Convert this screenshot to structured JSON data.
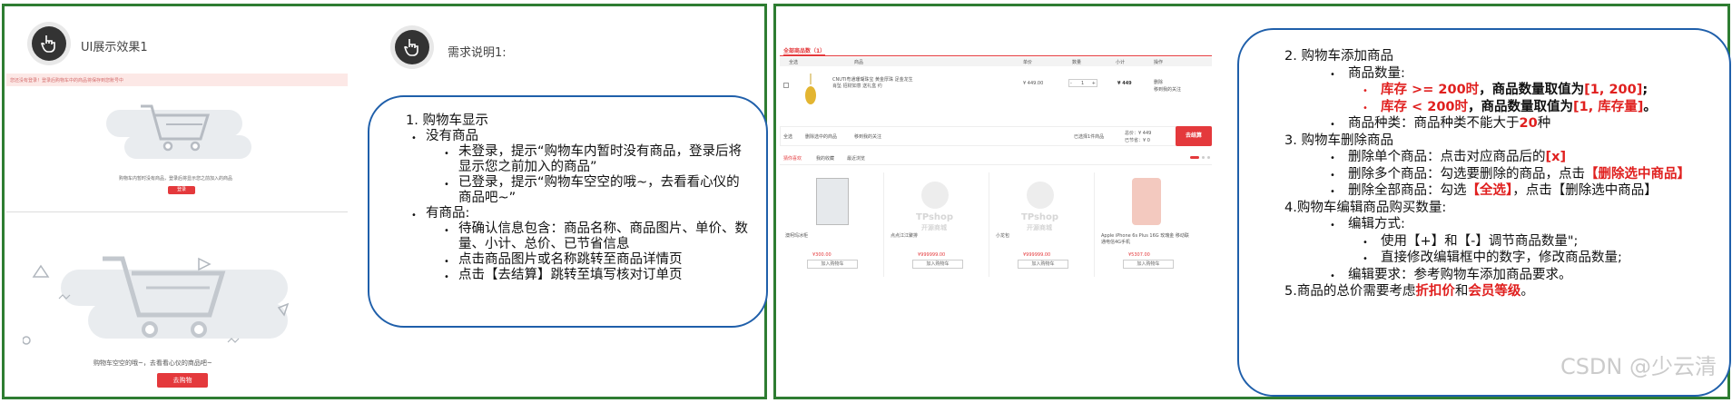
{
  "left_panel": {
    "title": "UI展示效果1",
    "notice_bar": "您还没有登录！登录后购物车中的商品将保存到您账号中",
    "empty1_text": "购物车内暂时没有商品，登录后将显示您之前加入的商品",
    "empty1_button": "登录",
    "empty2_text": "购物车空空的哦~，去看看心仪的商品吧~",
    "empty2_button": "去购物"
  },
  "requirements_panel": {
    "title": "需求说明1:",
    "heading": "1. 购物车显示",
    "no_items": "没有商品",
    "not_logged": "未登录，提示“购物车内暂时没有商品，登录后将显示您之前加入的商品”",
    "logged": "已登录，提示“购物车空空的哦~，去看看心仪的商品吧~”",
    "has_items": "有商品:",
    "item1": "待确认信息包含：商品名称、商品图片、单价、数量、小计、总价、已节省信息",
    "item2": "点击商品图片或名称跳转至商品详情页",
    "item3": "点击【去结算】跳转至填写核对订单页"
  },
  "cart_mock": {
    "tab": "全部商品数（1）",
    "headers": [
      "全选",
      "商品",
      "单价",
      "数量",
      "小计",
      "操作"
    ],
    "row": {
      "name": "CNUTI粤通珊瑚珠宝 黄金厚珠 足金龙生肖坠 招财如意 送礼盒 约",
      "price": "¥ 449.00",
      "qty": "1",
      "subtotal": "¥ 449",
      "ops": [
        "删除",
        "移到我的关注"
      ]
    },
    "footer": {
      "select_all": "全选",
      "delete_selected": "删除选中的商品",
      "move": "移到我的关注",
      "selected_count": "已选择1件商品",
      "total": "总价：¥ 449",
      "saved": "已节省：¥ 0",
      "checkout": "去结算"
    },
    "rec_tabs": [
      "猜你喜欢",
      "我的收藏",
      "最近浏览"
    ],
    "products": [
      {
        "name": "澳柯玛冰柜",
        "price": "¥300.00",
        "add": "加入购物车"
      },
      {
        "name": "点点江江聚排",
        "price": "¥999999.00",
        "add": "加入购物车"
      },
      {
        "name": "小龙包",
        "price": "¥999999.00",
        "add": "加入购物车"
      },
      {
        "name": "Apple iPhone 6s Plus 16G 玫瑰金 移动联通电信4G手机",
        "price": "¥5307.00",
        "add": "加入购物车"
      }
    ],
    "placeholder_text": "TPshop",
    "placeholder_sub": "开源商城"
  },
  "rules_panel": {
    "s2": "2. 购物车添加商品",
    "s2_qty": "商品数量:",
    "s2_rule1_red": "库存 >= 200时",
    "s2_rule1_mid": "，商品数量取值为",
    "s2_rule1_val": "[1, 200]",
    "s2_rule1_end": ";",
    "s2_rule2_red": "库存 < 200时",
    "s2_rule2_mid": "，商品数量取值为",
    "s2_rule2_val": "[1, 库存量]",
    "s2_rule2_end": "。",
    "s2_kind_pre": "商品种类：商品种类不能大于",
    "s2_kind_val": "20",
    "s2_kind_end": "种",
    "s3": "3. 购物车删除商品",
    "s3_single_pre": "删除单个商品：点击对应商品后的",
    "s3_single_val": "[x]",
    "s3_multi_pre": "删除多个商品：勾选要删除的商品，点击",
    "s3_multi_val": "【删除选中商品】",
    "s3_all_pre": "删除全部商品：勾选",
    "s3_all_val": "【全选】",
    "s3_all_end": "，点击【删除选中商品】",
    "s4": "4.购物车编辑商品购买数量:",
    "s4_mode": "编辑方式:",
    "s4_m1": "使用【+】和【-】调节商品数量\";",
    "s4_m2": "直接修改编辑框中的数字，修改商品数量;",
    "s4_req": "编辑要求：参考购物车添加商品要求。",
    "s5_pre": "5.商品的总价需要考虑",
    "s5_v1": "折扣价",
    "s5_mid": "和",
    "s5_v2": "会员等级",
    "s5_end": "。"
  },
  "watermark": "CSDN @少云清"
}
